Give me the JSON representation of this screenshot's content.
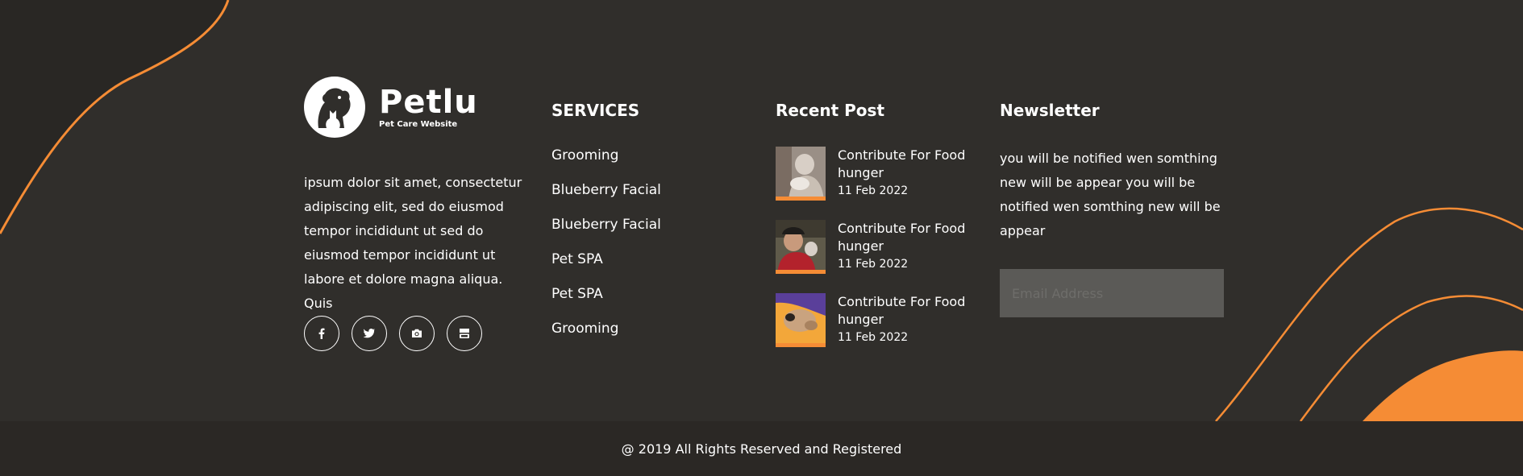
{
  "brand": {
    "name": "Petlu",
    "tagline": "Pet Care Website"
  },
  "about": {
    "text": "ipsum dolor sit amet, consectetur adipiscing elit, sed do eiusmod tempor incididunt ut sed do eiusmod tempor incididunt ut labore et dolore magna aliqua. Quis"
  },
  "social": [
    {
      "icon": "facebook-icon"
    },
    {
      "icon": "twitter-icon"
    },
    {
      "icon": "camera-icon"
    },
    {
      "icon": "youtube-icon"
    }
  ],
  "services": {
    "heading": "SERVICES",
    "items": [
      "Grooming",
      "Blueberry Facial",
      "Blueberry Facial",
      "Pet SPA",
      "Pet SPA",
      "Grooming"
    ]
  },
  "recent_posts": {
    "heading": "Recent Post",
    "items": [
      {
        "title": "Contribute For Food hunger",
        "date": "11 Feb 2022"
      },
      {
        "title": "Contribute For Food hunger",
        "date": "11 Feb 2022"
      },
      {
        "title": "Contribute For Food hunger",
        "date": "11 Feb 2022"
      }
    ]
  },
  "newsletter": {
    "heading": "Newsletter",
    "text": "you will be notified wen somthing new will be appear you will be notified wen somthing new will be appear",
    "placeholder": "Email Address"
  },
  "footer": {
    "copyright": "@ 2019 All Rights Reserved and Registered"
  },
  "colors": {
    "background": "#302e2b",
    "bottom_bar": "#2b2825",
    "accent": "#f58c35",
    "input": "#5b5a57"
  }
}
